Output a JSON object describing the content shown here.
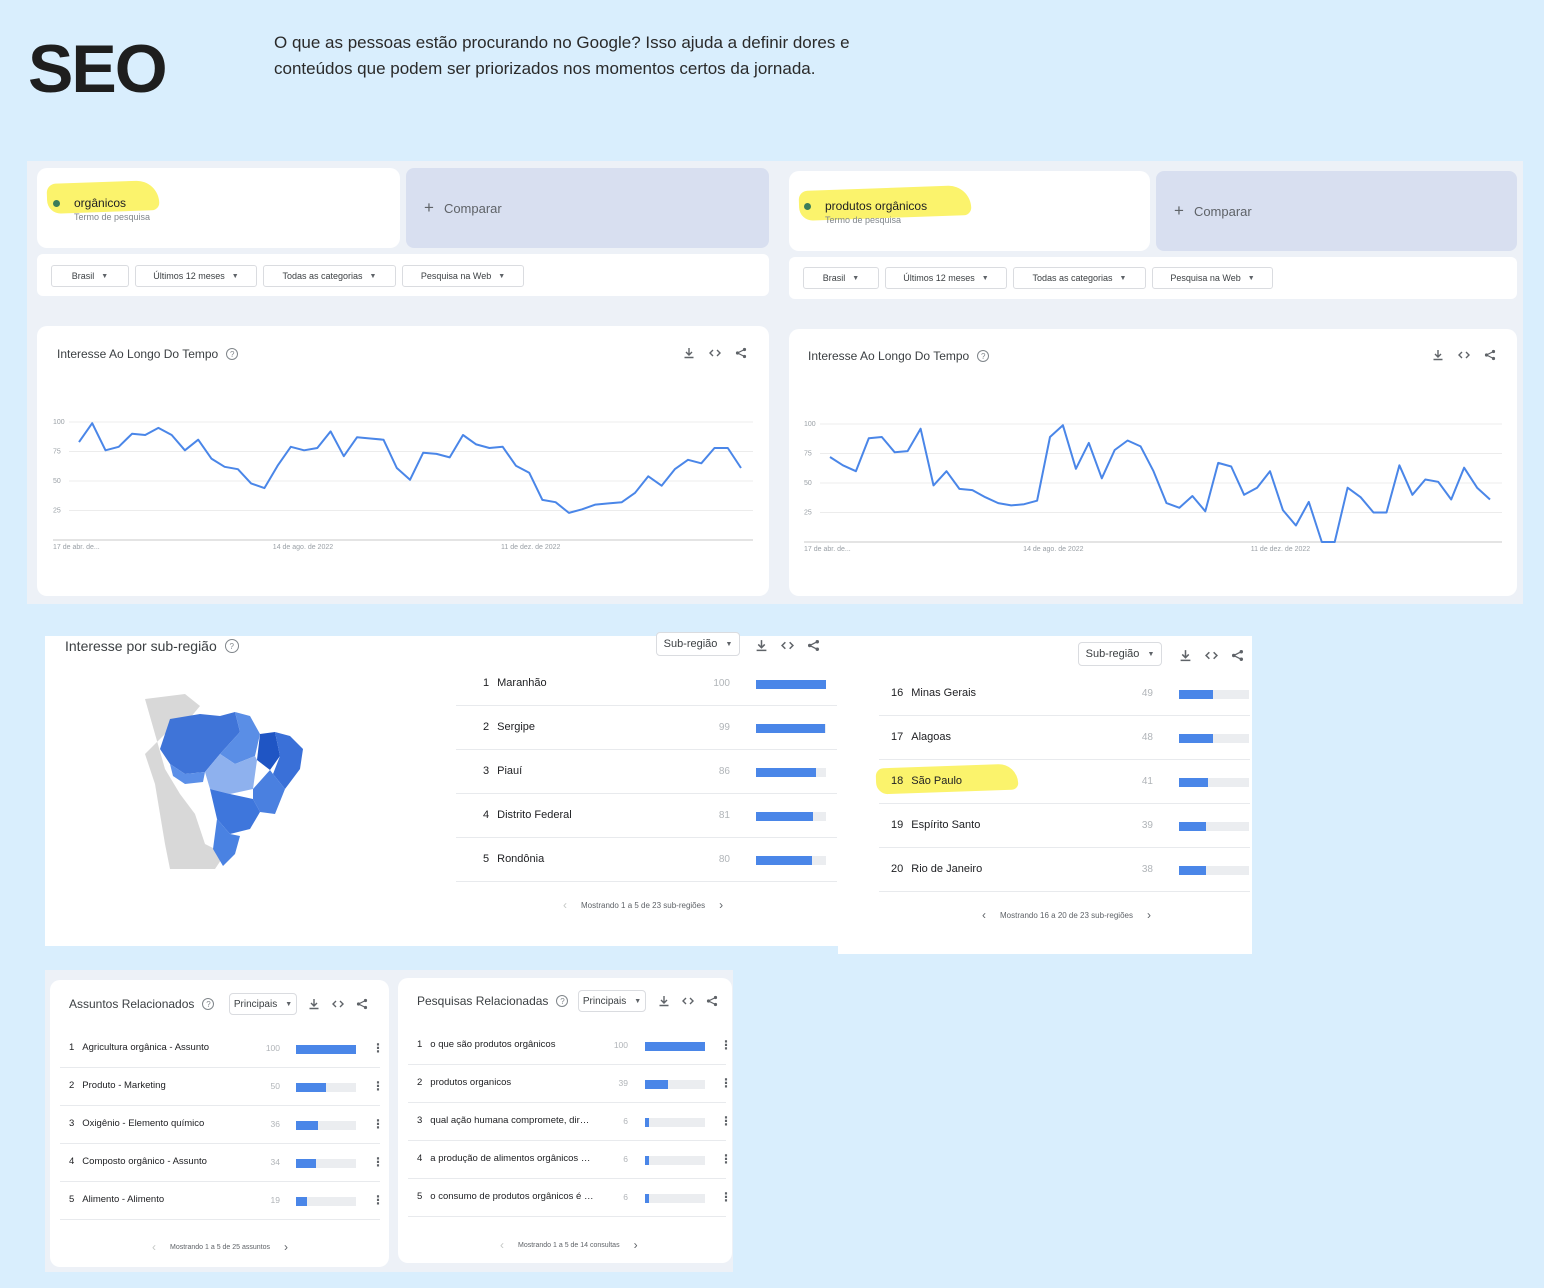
{
  "header": {
    "title": "SEO",
    "intro": "O que as pessoas estão procurando no Google? Isso ajuda a definir dores e conteúdos que podem ser priorizados nos momentos certos da jornada."
  },
  "left": {
    "term": "orgânicos",
    "term_sub": "Termo de pesquisa",
    "compare": "Comparar",
    "filters": [
      "Brasil",
      "Últimos 12 meses",
      "Todas as categorias",
      "Pesquisa na Web"
    ],
    "chart_title": "Interesse Ao Longo Do Tempo",
    "y_ticks": [
      "100",
      "75",
      "50",
      "25"
    ],
    "x_ticks": [
      "17 de abr. de...",
      "14 de ago. de 2022",
      "11 de dez. de 2022"
    ]
  },
  "right": {
    "term": "produtos orgânicos",
    "term_sub": "Termo de pesquisa",
    "compare": "Comparar",
    "filters": [
      "Brasil",
      "Últimos 12 meses",
      "Todas as categorias",
      "Pesquisa na Web"
    ],
    "chart_title": "Interesse Ao Longo Do Tempo",
    "y_ticks": [
      "100",
      "75",
      "50",
      "25"
    ],
    "x_ticks": [
      "17 de abr. de...",
      "14 de ago. de 2022",
      "11 de dez. de 2022"
    ]
  },
  "chart_data": [
    {
      "type": "line",
      "title": "Interesse Ao Longo Do Tempo",
      "term": "orgânicos",
      "ylim": [
        0,
        100
      ],
      "grid": true,
      "values": [
        83,
        99,
        76,
        79,
        90,
        89,
        95,
        89,
        76,
        85,
        69,
        62,
        60,
        48,
        44,
        63,
        79,
        76,
        78,
        92,
        71,
        87,
        86,
        85,
        61,
        51,
        74,
        73,
        70,
        89,
        81,
        78,
        79,
        63,
        57,
        34,
        32,
        23,
        26,
        30,
        31,
        32,
        40,
        54,
        46,
        60,
        68,
        65,
        78,
        78,
        61
      ]
    },
    {
      "type": "line",
      "title": "Interesse Ao Longo Do Tempo",
      "term": "produtos orgânicos",
      "ylim": [
        0,
        100
      ],
      "grid": true,
      "values": [
        72,
        65,
        60,
        88,
        89,
        76,
        77,
        96,
        48,
        60,
        45,
        44,
        38,
        33,
        31,
        32,
        35,
        89,
        99,
        62,
        84,
        54,
        78,
        86,
        81,
        60,
        33,
        29,
        39,
        26,
        67,
        64,
        40,
        46,
        60,
        27,
        14,
        34,
        0,
        0,
        46,
        38,
        25,
        25,
        65,
        40,
        53,
        51,
        36,
        63,
        46,
        36
      ]
    }
  ],
  "subregion": {
    "title": "Interesse por sub-região",
    "dropdown": "Sub-região",
    "rows_a": [
      {
        "rank": "1",
        "name": "Maranhão",
        "value": 100
      },
      {
        "rank": "2",
        "name": "Sergipe",
        "value": 99
      },
      {
        "rank": "3",
        "name": "Piauí",
        "value": 86
      },
      {
        "rank": "4",
        "name": "Distrito Federal",
        "value": 81
      },
      {
        "rank": "5",
        "name": "Rondônia",
        "value": 80
      }
    ],
    "pager_a": "Mostrando 1 a 5 de 23 sub-regiões",
    "rows_b": [
      {
        "rank": "16",
        "name": "Minas Gerais",
        "value": 49
      },
      {
        "rank": "17",
        "name": "Alagoas",
        "value": 48
      },
      {
        "rank": "18",
        "name": "São Paulo",
        "value": 41
      },
      {
        "rank": "19",
        "name": "Espírito Santo",
        "value": 39
      },
      {
        "rank": "20",
        "name": "Rio de Janeiro",
        "value": 38
      }
    ],
    "pager_b": "Mostrando 16 a 20 de 23 sub-regiões"
  },
  "related_topics": {
    "title": "Assuntos Relacionados",
    "dropdown": "Principais",
    "rows": [
      {
        "rank": "1",
        "name": "Agricultura orgânica - Assunto",
        "value": 100
      },
      {
        "rank": "2",
        "name": "Produto - Marketing",
        "value": 50
      },
      {
        "rank": "3",
        "name": "Oxigênio - Elemento químico",
        "value": 36
      },
      {
        "rank": "4",
        "name": "Composto orgânico - Assunto",
        "value": 34
      },
      {
        "rank": "5",
        "name": "Alimento - Alimento",
        "value": 19
      }
    ],
    "pager": "Mostrando 1 a 5 de 25 assuntos"
  },
  "related_queries": {
    "title": "Pesquisas Relacionadas",
    "dropdown": "Principais",
    "rows": [
      {
        "rank": "1",
        "name": "o que são produtos orgânicos",
        "value": 100
      },
      {
        "rank": "2",
        "name": "produtos organicos",
        "value": 39
      },
      {
        "rank": "3",
        "name": "qual ação humana compromete, diretamen...",
        "value": 6
      },
      {
        "rank": "4",
        "name": "a produção de alimentos orgânicos pode aj...",
        "value": 6
      },
      {
        "rank": "5",
        "name": "o consumo de produtos orgânicos é benefi...",
        "value": 6
      }
    ],
    "pager": "Mostrando 1 a 5 de 14 consultas"
  },
  "colors": {
    "line": "#4a86e8",
    "bar": "#4a86e8",
    "highlight": "#fbf36c",
    "page_bg": "#d9eefd"
  },
  "icons": [
    "download-icon",
    "embed-icon",
    "share-icon",
    "help-icon",
    "plus-icon",
    "chevron-left-icon",
    "chevron-right-icon",
    "more-vert-icon"
  ]
}
